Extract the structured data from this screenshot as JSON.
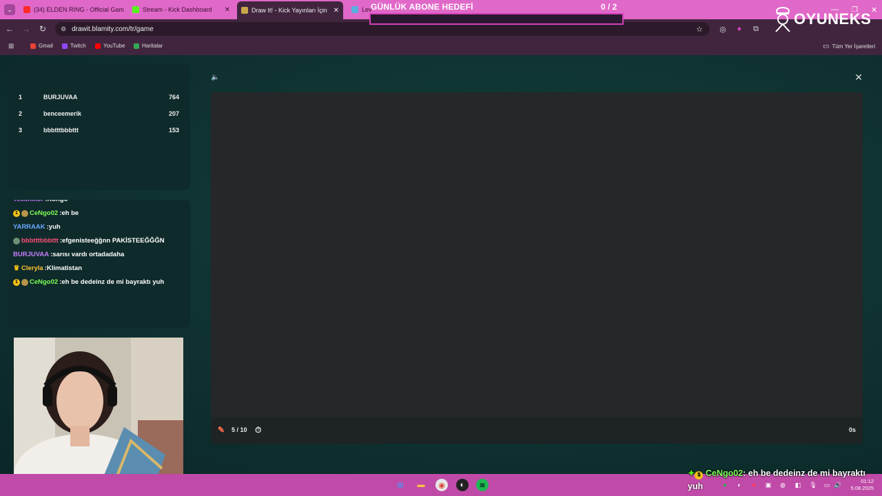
{
  "browser": {
    "tabs": [
      {
        "title": "(34) ELDEN RING - Official Gam",
        "color": "#ff2a2a"
      },
      {
        "title": "Stream - Kick Dashboard",
        "color": "#53fc18"
      },
      {
        "title": "Draw It! - Kick Yayınları İçin Çiz",
        "color": "#c9a64a"
      },
      {
        "title": "Lev",
        "color": "#58b0e0"
      }
    ],
    "address": "drawit.blamity.com/tr/game",
    "bookmarks": [
      {
        "label": "Gmail",
        "color": "#ea4335"
      },
      {
        "label": "Twitch",
        "color": "#9146ff"
      },
      {
        "label": "YouTube",
        "color": "#ff0000"
      },
      {
        "label": "Haritalar",
        "color": "#34a853"
      }
    ],
    "all_bookmarks": "Tüm Yer İşaretleri"
  },
  "overlay": {
    "goal_title": "GÜNLÜK ABONE HEDEFİ",
    "goal_count": "0 / 2",
    "goal_progress": 0,
    "logo_text": "OYUNEKS"
  },
  "leaderboard": [
    {
      "rank": "1",
      "name": "BURJUVAA",
      "score": "764"
    },
    {
      "rank": "2",
      "name": "benceemerik",
      "score": "207"
    },
    {
      "rank": "3",
      "name": "bbbtttbbbttt",
      "score": "153"
    }
  ],
  "chat": [
    {
      "user": "Tellxhikor",
      "msg": ":Kongo",
      "color": "#c77dff",
      "badges": []
    },
    {
      "user": "CeNgo02",
      "msg": ":eh be",
      "color": "#7dff5a",
      "badges": [
        "1",
        "c"
      ]
    },
    {
      "user": "YARRAAK",
      "msg": ":yuh",
      "color": "#6aa8ff",
      "badges": []
    },
    {
      "user": "bbbtttbbbttt",
      "msg": ":efgenisteeğğnn PAKİSTEEĞĞĞN",
      "color": "#ff4f7a",
      "badges": [
        "g"
      ]
    },
    {
      "user": "BURJUVAA",
      "msg": ":sarısı vardı ortadadaha",
      "color": "#c77dff",
      "badges": []
    },
    {
      "user": "Cleryla",
      "msg": ":Klimatistan",
      "color": "#ffc533",
      "badges": [
        "crown"
      ]
    },
    {
      "user": "CeNgo02",
      "msg": ":eh be dedeinz de mi bayraktı yuh",
      "color": "#7dff5a",
      "badges": [
        "1",
        "c"
      ]
    }
  ],
  "game": {
    "rounds": "5 / 10",
    "seconds": "0s"
  },
  "overlay_chat": {
    "user": "CeNgo02",
    "msg": ": eh be dedeinz de mi bayraktı",
    "cont": "yuh"
  },
  "clock": {
    "time": "01:12",
    "date": "5.08.2025"
  }
}
